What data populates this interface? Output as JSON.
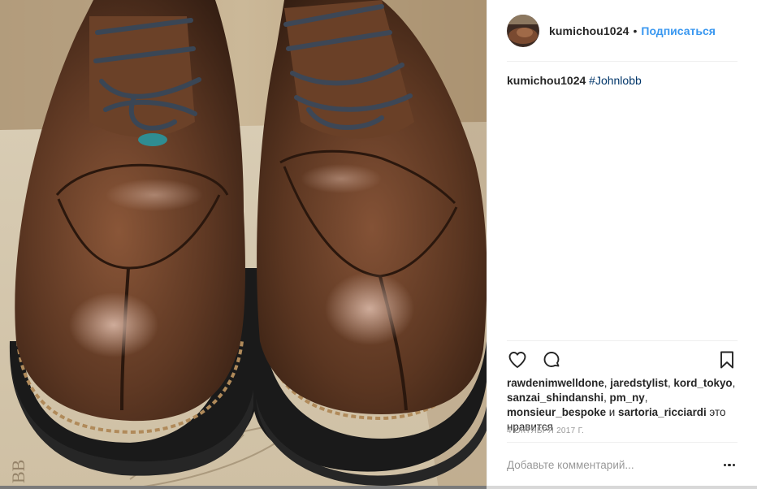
{
  "post": {
    "image": {
      "alt_name": "brown-leather-shoes-photo"
    },
    "header": {
      "username": "kumichou1024",
      "separator": "•",
      "follow_label": "Подписаться"
    },
    "caption": {
      "username": "kumichou1024",
      "hashtag": "#Johnlobb"
    },
    "actions": {
      "like_icon": "heart-icon",
      "comment_icon": "comment-icon",
      "save_icon": "bookmark-icon"
    },
    "likes": {
      "users_line1": [
        "rawdenimwelldone",
        "jaredstylist",
        "kord_tokyo"
      ],
      "users_line2": [
        "sanzai_shindanshi",
        "pm_ny",
        "monsieur_bespoke"
      ],
      "conjunction": "и",
      "last_user": "sartoria_ricciardi",
      "suffix": "это нравится"
    },
    "timestamp": "4 октября 2017 г.",
    "comment": {
      "placeholder": "Добавьте комментарий...",
      "more_icon": "more-options-icon"
    },
    "colors": {
      "link_blue": "#3897f0",
      "hashtag_blue": "#003569",
      "text": "#262626",
      "muted": "#999999",
      "divider": "#efefef"
    }
  }
}
